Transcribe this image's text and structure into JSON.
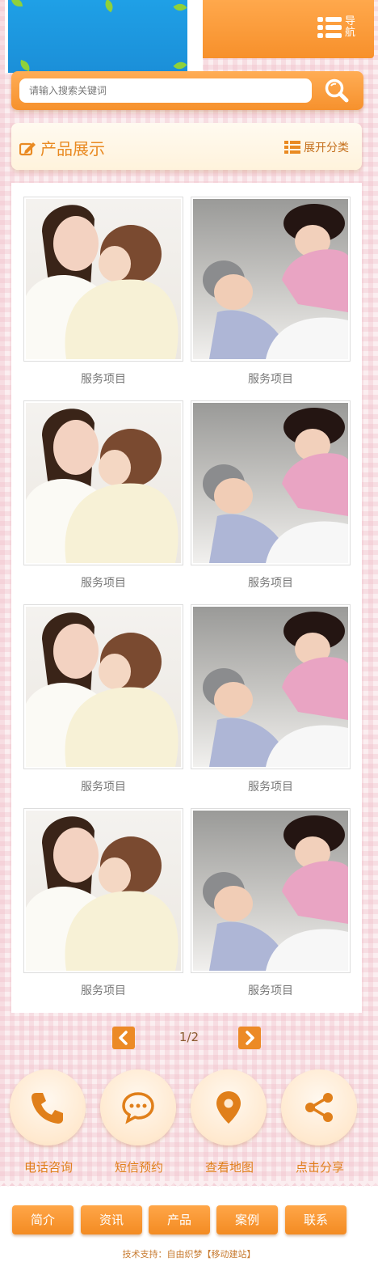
{
  "header": {
    "nav_label": "导航"
  },
  "search": {
    "placeholder": "请输入搜索关键词"
  },
  "section": {
    "title": "产品展示",
    "more_label": "展开分类"
  },
  "products": [
    {
      "caption": "服务项目",
      "photo": "mother-baby"
    },
    {
      "caption": "服务项目",
      "photo": "nurse-elderly"
    },
    {
      "caption": "服务项目",
      "photo": "mother-baby"
    },
    {
      "caption": "服务项目",
      "photo": "nurse-elderly"
    },
    {
      "caption": "服务项目",
      "photo": "mother-baby"
    },
    {
      "caption": "服务项目",
      "photo": "nurse-elderly"
    },
    {
      "caption": "服务项目",
      "photo": "mother-baby"
    },
    {
      "caption": "服务项目",
      "photo": "nurse-elderly"
    }
  ],
  "pager": {
    "page_text": "1/2"
  },
  "features": [
    {
      "label": "电话咨询",
      "icon": "phone-icon"
    },
    {
      "label": "短信预约",
      "icon": "message-icon"
    },
    {
      "label": "查看地图",
      "icon": "map-pin-icon"
    },
    {
      "label": "点击分享",
      "icon": "share-icon"
    }
  ],
  "footer_menu": [
    "简介",
    "资讯",
    "产品",
    "案例",
    "联系"
  ],
  "footer": {
    "prefix": "技术支持：",
    "company": "自由织梦",
    "link": "【移动建站】"
  },
  "colors": {
    "accent": "#f7902b",
    "accent_dark": "#e98a22",
    "bg_pink": "#fbeef0",
    "text_gray": "#777777"
  }
}
